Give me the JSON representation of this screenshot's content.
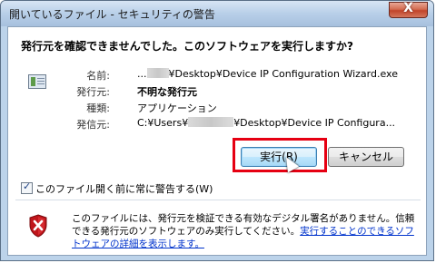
{
  "window": {
    "title": "開いているファイル - セキュリティの警告",
    "close_glyph": "X"
  },
  "dialog": {
    "question": "発行元を確認できませんでした。このソフトウェアを実行しますか?",
    "props": {
      "name_label": "名前:",
      "name_prefix": "...",
      "name_value": "¥Desktop¥Device IP Configuration Wizard.exe",
      "publisher_label": "発行元:",
      "publisher_value": "不明な発行元",
      "type_label": "種類:",
      "type_value": "アプリケーション",
      "from_label": "発信元:",
      "from_prefix": "C:¥Users¥",
      "from_value": "¥Desktop¥Device IP Configura..."
    },
    "buttons": {
      "run": "実行(R)",
      "cancel": "キャンセル"
    },
    "always_ask_label": "このファイル開く前に常に警告する(W)",
    "always_ask_checked": true,
    "notice_text": "このファイルには、発行元を検証できる有効なデジタル署名がありません。信頼できる発行元のソフトウェアのみ実行してください。",
    "notice_link": "実行することのできるソフトウェアの詳細を表示します。"
  },
  "icons": {
    "file": "file-icon",
    "shield": "shield-warning-icon"
  },
  "colors": {
    "highlight": "#e60012",
    "link": "#0033cc",
    "shield_red": "#c0151b"
  }
}
